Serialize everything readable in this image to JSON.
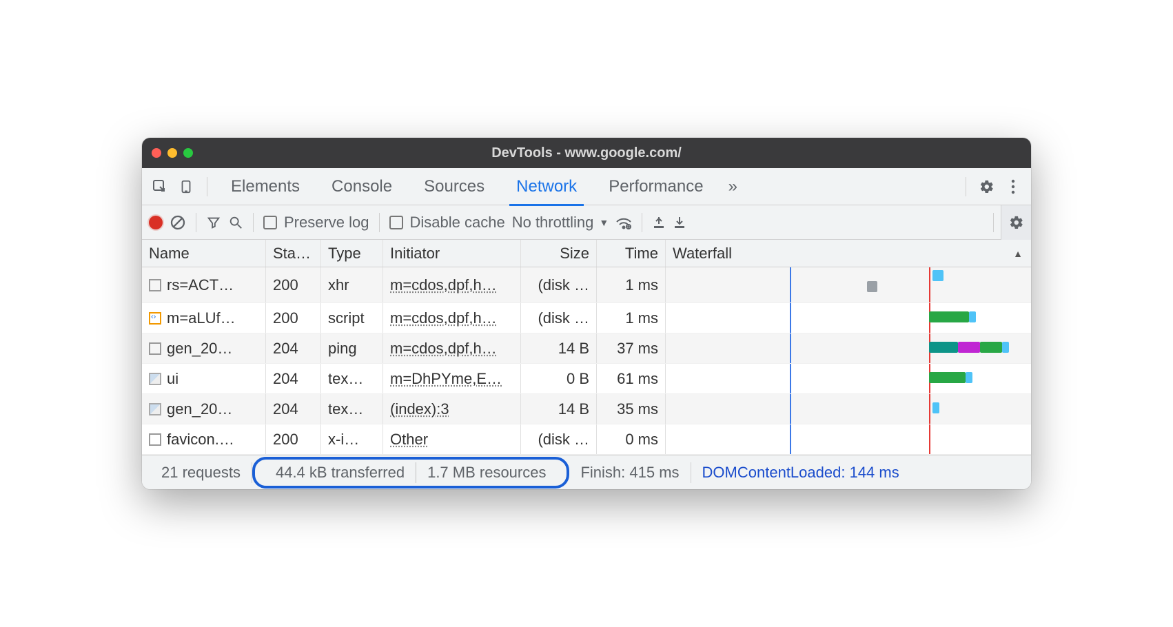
{
  "window": {
    "title": "DevTools - www.google.com/"
  },
  "tabs": {
    "items": [
      "Elements",
      "Console",
      "Sources",
      "Network",
      "Performance"
    ],
    "active": "Network",
    "overflow": "»"
  },
  "toolbar": {
    "preserve_log": "Preserve log",
    "disable_cache": "Disable cache",
    "throttling": "No throttling"
  },
  "columns": {
    "name": "Name",
    "status": "Sta…",
    "type": "Type",
    "initiator": "Initiator",
    "size": "Size",
    "time": "Time",
    "waterfall": "Waterfall"
  },
  "rows": [
    {
      "icon": "doc",
      "name": "rs=ACT…",
      "status": "200",
      "type": "xhr",
      "initiator": "m=cdos,dpf,h…",
      "size": "(disk …",
      "time": "1 ms"
    },
    {
      "icon": "script",
      "name": "m=aLUf…",
      "status": "200",
      "type": "script",
      "initiator": "m=cdos,dpf,h…",
      "size": "(disk …",
      "time": "1 ms"
    },
    {
      "icon": "doc",
      "name": "gen_20…",
      "status": "204",
      "type": "ping",
      "initiator": "m=cdos,dpf,h…",
      "size": "14 B",
      "time": "37 ms"
    },
    {
      "icon": "img",
      "name": "ui",
      "status": "204",
      "type": "tex…",
      "initiator": "m=DhPYme,E…",
      "size": "0 B",
      "time": "61 ms"
    },
    {
      "icon": "img",
      "name": "gen_20…",
      "status": "204",
      "type": "tex…",
      "initiator": "(index):3",
      "size": "14 B",
      "time": "35 ms"
    },
    {
      "icon": "doc",
      "name": "favicon.…",
      "status": "200",
      "type": "x-i…",
      "initiator": "Other",
      "size": "(disk …",
      "time": "0 ms"
    }
  ],
  "footer": {
    "requests": "21 requests",
    "transferred": "44.4 kB transferred",
    "resources": "1.7 MB resources",
    "finish": "Finish: 415 ms",
    "dcl": "DOMContentLoaded: 144 ms"
  }
}
